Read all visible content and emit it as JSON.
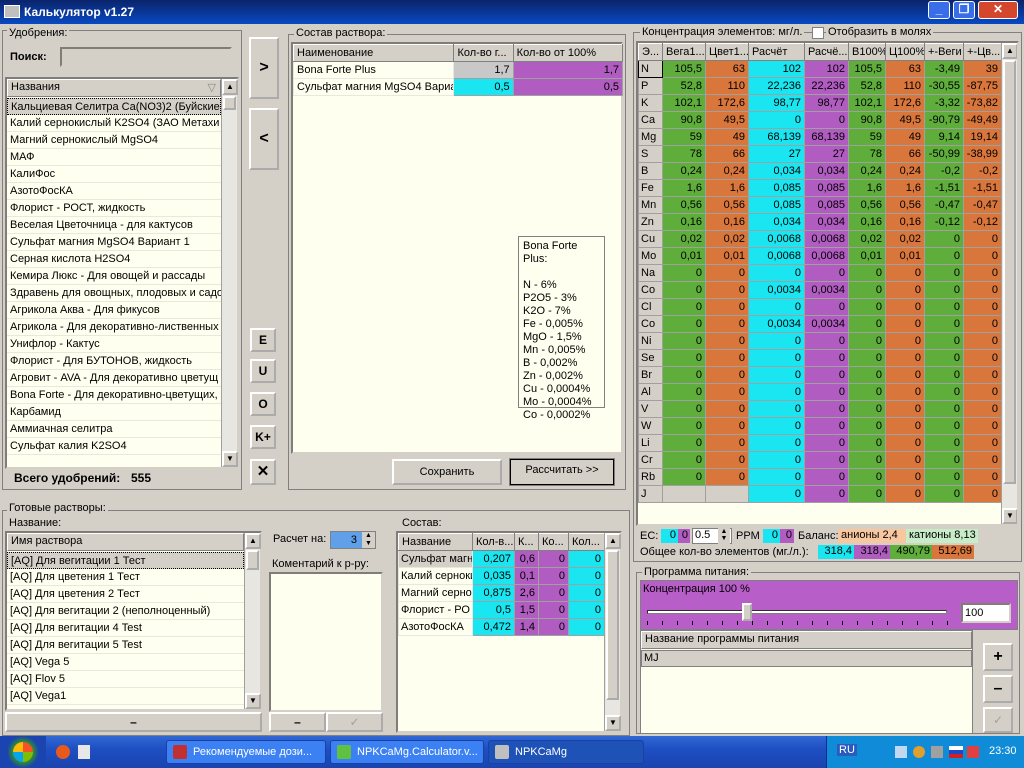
{
  "app": {
    "title": "Калькулятор v1.27"
  },
  "fert": {
    "group": "Удобрения:",
    "search_label": "Поиск:",
    "search_value": "",
    "col_header": "Названия",
    "total_label": "Всего удобрений:",
    "total": "555",
    "items": [
      "Кальциевая Селитра Ca(NO3)2 (Буйские у",
      "Калий сернокислый K2SO4 (ЗАО Метахи",
      "Магний сернокислый MgSO4",
      "МАФ",
      "КалиФос",
      "АзотоФосКА",
      "Флорист - РОСТ, жидкость",
      "Веселая Цветочница - для кактусов",
      "Сульфат магния MgSO4 Вариант 1",
      "Серная кислота H2SO4",
      "Кемира Люкс - Для овощей и рассады",
      "Здравень для овощных, плодовых и садо",
      "Агрикола Аква - Для фикусов",
      "Агрикола - Для декоративно-лиственных",
      "Унифлор - Кактус",
      "Флорист - Для БУТОНОВ, жидкость",
      "Агровит - AVA - Для декоративно цветущ",
      "Bona Forte - Для декоративно-цветущих, ж",
      "Карбамид",
      "Аммиачная селитра",
      "Сульфат калия K2SO4"
    ]
  },
  "mid": {
    "add": ">",
    "remove": "<",
    "e": "E",
    "u": "U",
    "o": "O",
    "k": "K+",
    "x": "✕"
  },
  "solution": {
    "group": "Состав раствора:",
    "headers": [
      "Наименование",
      "Кол-во г...",
      "Кол-во от 100%"
    ],
    "rows": [
      {
        "name": "Bona Forte Plus",
        "qty": "1,7",
        "pct": "1,7"
      },
      {
        "name": "Сульфат магния MgSO4 Вариа",
        "qty": "0,5",
        "pct": "0,5"
      }
    ],
    "tooltip_title": "Bona Forte Plus:",
    "tooltip_lines": [
      "N - 6%",
      "P2O5 - 3%",
      "K2O - 7%",
      "Fe - 0,005%",
      "MgO - 1,5%",
      "Mn - 0,005%",
      "B - 0,002%",
      "Zn - 0,002%",
      "Cu - 0,0004%",
      "Mo - 0,0004%",
      "Co - 0,0002%"
    ],
    "save": "Сохранить",
    "calc": "Рассчитать >>"
  },
  "conc": {
    "group": "Концентрация элементов: мг/л.",
    "moles_label": "Отобразить в молях",
    "headers": [
      "Э...",
      "Вега1...",
      "Цвет1...",
      "Расчёт",
      "Расчё...",
      "В100%",
      "Ц100%",
      "+-Веги",
      "+-Цв..."
    ],
    "rows": [
      [
        "N",
        "105,5",
        "63",
        "102",
        "102",
        "105,5",
        "63",
        "-3,49",
        "39"
      ],
      [
        "P",
        "52,8",
        "110",
        "22,236",
        "22,236",
        "52,8",
        "110",
        "-30,55",
        "-87,75"
      ],
      [
        "K",
        "102,1",
        "172,6",
        "98,77",
        "98,77",
        "102,1",
        "172,6",
        "-3,32",
        "-73,82"
      ],
      [
        "Ca",
        "90,8",
        "49,5",
        "0",
        "0",
        "90,8",
        "49,5",
        "-90,79",
        "-49,49"
      ],
      [
        "Mg",
        "59",
        "49",
        "68,139",
        "68,139",
        "59",
        "49",
        "9,14",
        "19,14"
      ],
      [
        "S",
        "78",
        "66",
        "27",
        "27",
        "78",
        "66",
        "-50,99",
        "-38,99"
      ],
      [
        "B",
        "0,24",
        "0,24",
        "0,034",
        "0,034",
        "0,24",
        "0,24",
        "-0,2",
        "-0,2"
      ],
      [
        "Fe",
        "1,6",
        "1,6",
        "0,085",
        "0,085",
        "1,6",
        "1,6",
        "-1,51",
        "-1,51"
      ],
      [
        "Mn",
        "0,56",
        "0,56",
        "0,085",
        "0,085",
        "0,56",
        "0,56",
        "-0,47",
        "-0,47"
      ],
      [
        "Zn",
        "0,16",
        "0,16",
        "0,034",
        "0,034",
        "0,16",
        "0,16",
        "-0,12",
        "-0,12"
      ],
      [
        "Cu",
        "0,02",
        "0,02",
        "0,0068",
        "0,0068",
        "0,02",
        "0,02",
        "0",
        "0"
      ],
      [
        "Mo",
        "0,01",
        "0,01",
        "0,0068",
        "0,0068",
        "0,01",
        "0,01",
        "0",
        "0"
      ],
      [
        "Na",
        "0",
        "0",
        "0",
        "0",
        "0",
        "0",
        "0",
        "0"
      ],
      [
        "Co",
        "0",
        "0",
        "0,0034",
        "0,0034",
        "0",
        "0",
        "0",
        "0"
      ],
      [
        "Cl",
        "0",
        "0",
        "0",
        "0",
        "0",
        "0",
        "0",
        "0"
      ],
      [
        "Co",
        "0",
        "0",
        "0,0034",
        "0,0034",
        "0",
        "0",
        "0",
        "0"
      ],
      [
        "Ni",
        "0",
        "0",
        "0",
        "0",
        "0",
        "0",
        "0",
        "0"
      ],
      [
        "Se",
        "0",
        "0",
        "0",
        "0",
        "0",
        "0",
        "0",
        "0"
      ],
      [
        "Br",
        "0",
        "0",
        "0",
        "0",
        "0",
        "0",
        "0",
        "0"
      ],
      [
        "Al",
        "0",
        "0",
        "0",
        "0",
        "0",
        "0",
        "0",
        "0"
      ],
      [
        "V",
        "0",
        "0",
        "0",
        "0",
        "0",
        "0",
        "0",
        "0"
      ],
      [
        "W",
        "0",
        "0",
        "0",
        "0",
        "0",
        "0",
        "0",
        "0"
      ],
      [
        "Li",
        "0",
        "0",
        "0",
        "0",
        "0",
        "0",
        "0",
        "0"
      ],
      [
        "Cr",
        "0",
        "0",
        "0",
        "0",
        "0",
        "0",
        "0",
        "0"
      ],
      [
        "Rb",
        "0",
        "0",
        "0",
        "0",
        "0",
        "0",
        "0",
        "0"
      ],
      [
        "J",
        "",
        "",
        "0",
        "0",
        "0",
        "0",
        "0",
        "0"
      ]
    ],
    "ec_label": "EC:",
    "ec1": "0",
    "ec2": "0",
    "ec_spin": "0.5",
    "ppm_label": "PPM",
    "ppm1": "0",
    "ppm2": "0",
    "balance_label": "Баланс:",
    "anions_label": "анионы",
    "anions": "2,4",
    "cations_label": "катионы",
    "cations": "8,13",
    "total_label": "Общее кол-во элементов (мг./л.):",
    "totals": [
      "318,4",
      "318,4",
      "490,79",
      "512,69"
    ]
  },
  "ready": {
    "group": "Готовые растворы:",
    "name_label": "Название:",
    "col_header": "Имя раствора",
    "items": [
      "[AQ] Для вегитации 1 Тест",
      "[AQ] Для цветения 1 Тест",
      "[AQ] Для цветения 2 Тест",
      "[AQ] Для вегитации 2 (неполноценный)",
      "[AQ] Для вегитации 4 Test",
      "[AQ] Для вегитации 5 Test",
      "[AQ] Vega 5",
      "[AQ] Flov 5",
      "[AQ] Vega1"
    ],
    "minus": "–",
    "calc_label": "Расчет на:",
    "calc_value": "3",
    "comment_label": "Коментарий к р-ру:",
    "check": "✓"
  },
  "composition": {
    "group": "Состав:",
    "headers": [
      "Название",
      "Кол-в...",
      "К...",
      "Ко...",
      "Кол..."
    ],
    "rows": [
      [
        "Сульфат магн",
        "0,207",
        "0,6",
        "0",
        "0"
      ],
      [
        "Калий  серноки",
        "0,035",
        "0,1",
        "0",
        "0"
      ],
      [
        "Магний серно",
        "0,875",
        "2,6",
        "0",
        "0"
      ],
      [
        "Флорист - РО",
        "0,5",
        "1,5",
        "0",
        "0"
      ],
      [
        "АзотоФосКА",
        "0,472",
        "1,4",
        "0",
        "0"
      ]
    ]
  },
  "program": {
    "group": "Программа питания:",
    "conc_label": "Концентрация 100 %",
    "slider_value": "100",
    "slider_fraction": 0.33,
    "col_header": "Название программы питания",
    "items": [
      "MJ"
    ],
    "plus": "+",
    "minus": "–",
    "check": "✓"
  },
  "taskbar": {
    "items": [
      "Рекомендуемые дози...",
      "NPKCaMg.Calculator.v...",
      "NPKCaMg"
    ],
    "lang": "RU",
    "clock": "23:30"
  },
  "colors": {
    "green": "#5fae3c",
    "orange": "#d9763c",
    "cyan": "#19e6f0",
    "magenta": "#b15cc0"
  }
}
